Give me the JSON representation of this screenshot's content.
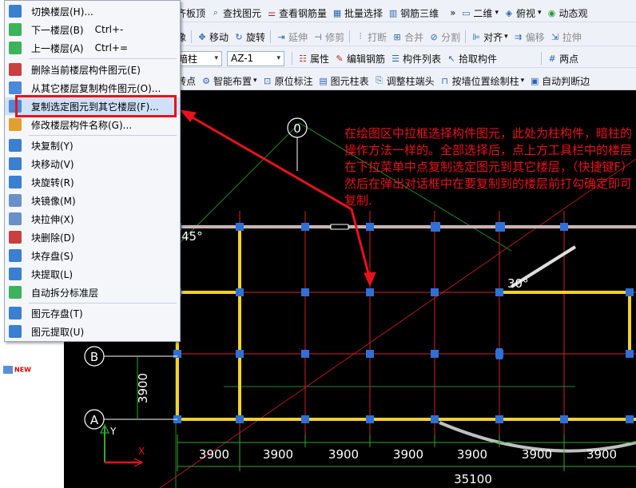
{
  "menu": {
    "items": [
      {
        "label": "切换楼层(H)...",
        "shortcut": ""
      },
      {
        "label": "下一楼层(B)",
        "shortcut": "Ctrl+-"
      },
      {
        "label": "上一楼层(A)",
        "shortcut": "Ctrl+="
      },
      {
        "label": "删除当前楼层构件图元(E)",
        "shortcut": ""
      },
      {
        "label": "从其它楼层复制构件图元(O)...",
        "shortcut": ""
      },
      {
        "label": "复制选定图元到其它楼层(F)...",
        "shortcut": ""
      },
      {
        "label": "修改楼层构件名称(G)...",
        "shortcut": ""
      },
      {
        "label": "块复制(Y)",
        "shortcut": ""
      },
      {
        "label": "块移动(V)",
        "shortcut": ""
      },
      {
        "label": "块旋转(R)",
        "shortcut": ""
      },
      {
        "label": "块镜像(M)",
        "shortcut": ""
      },
      {
        "label": "块拉伸(X)",
        "shortcut": ""
      },
      {
        "label": "块删除(D)",
        "shortcut": ""
      },
      {
        "label": "块存盘(S)",
        "shortcut": ""
      },
      {
        "label": "块提取(L)",
        "shortcut": ""
      },
      {
        "label": "自动拆分标准层",
        "shortcut": ""
      },
      {
        "label": "图元存盘(T)",
        "shortcut": ""
      },
      {
        "label": "图元提取(U)",
        "shortcut": ""
      }
    ],
    "highlighted_item": "复制选定图元到其它楼层(F)..."
  },
  "toolbar": {
    "row1": [
      "齐板顶",
      "查找图元",
      "查看钢筋量",
      "批量选择",
      "钢筋三维",
      "二维",
      "俯视",
      "动态观"
    ],
    "row2": [
      "像",
      "移动",
      "旋转",
      "延伸",
      "修剪",
      "打断",
      "合并",
      "分割",
      "对齐",
      "偏移",
      "拉伸"
    ],
    "row3": {
      "type_combo": "暗柱",
      "name_combo": "AZ-1",
      "buttons": [
        "属性",
        "编辑钢筋",
        "构件列表",
        "拾取构件",
        "两点"
      ]
    },
    "row4": [
      "转点",
      "智能布置",
      "原位标注",
      "图元柱表",
      "调整柱端头",
      "按墙位置绘制柱",
      "自动判断边"
    ]
  },
  "left_panel": {
    "new_badge": "NEW"
  },
  "canvas": {
    "axis_labels": {
      "top": "0",
      "left_b": "B",
      "left_a": "A"
    },
    "angle_labels": [
      "45°",
      "30°"
    ],
    "dimensions": {
      "left_vertical": "3900",
      "spans": [
        "3900",
        "3900",
        "3900",
        "3900",
        "3900",
        "3900",
        "3900"
      ],
      "total": "35100"
    },
    "axes_icon": {
      "y": "Y",
      "x": "X"
    }
  },
  "annotation": {
    "text": "在绘图区中拉框选择构件图元，此处为柱构件，暗柱的操作方法一样的。全部选择后，点上方工具栏中的楼层在下拉菜单中点复制选定图元到其它楼层，（快捷键F）然后在弹出对话框中在要复制到的楼层前打勾确定即可复制."
  },
  "colors": {
    "annotation": "#e8121b",
    "beam": "#f2d22a",
    "grid": "#d82020",
    "column": "#2f6fd8",
    "highlight": "#cfe0f7"
  }
}
